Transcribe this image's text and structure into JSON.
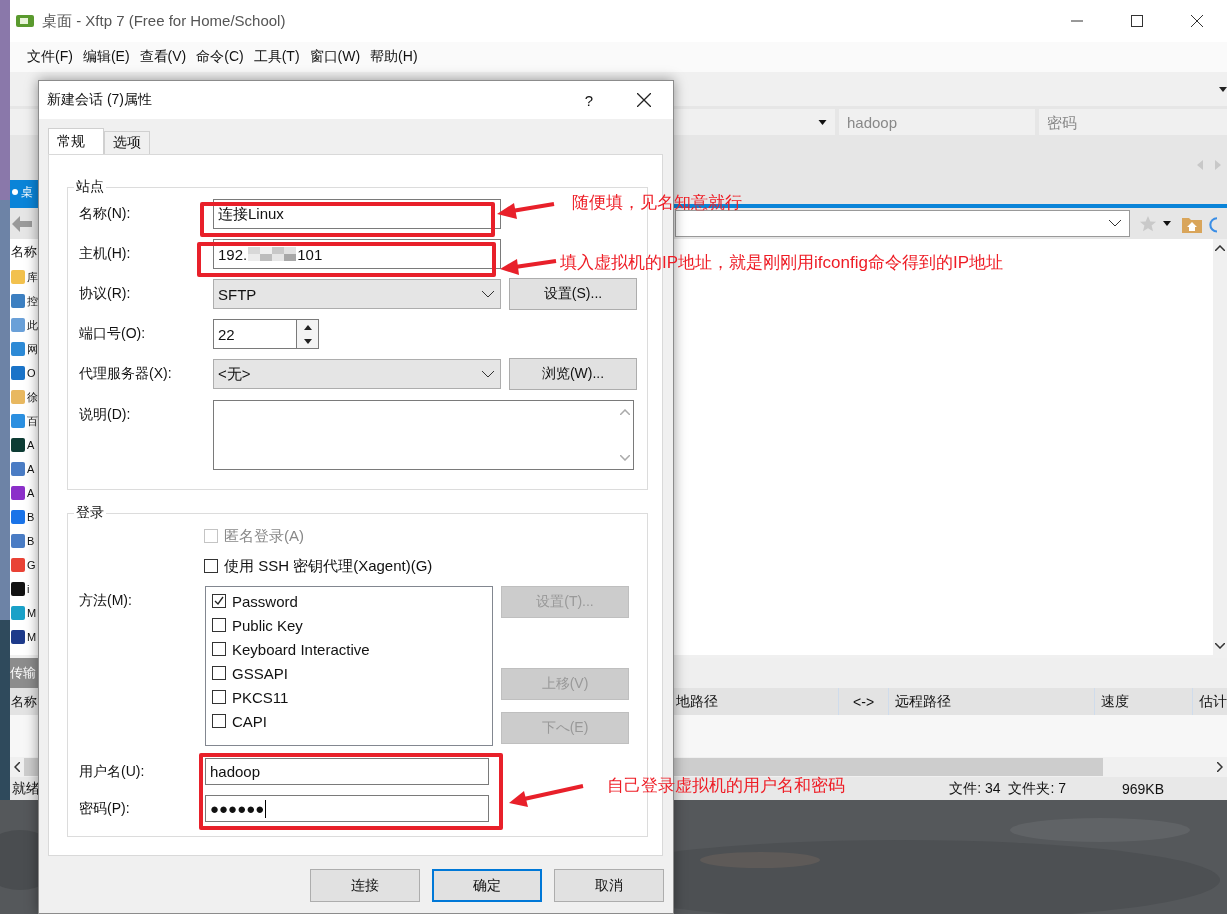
{
  "app_window": {
    "title": "桌面 - Xftp 7 (Free for Home/School)",
    "menu": [
      "文件(F)",
      "编辑(E)",
      "查看(V)",
      "命令(C)",
      "工具(T)",
      "窗口(W)",
      "帮助(H)"
    ],
    "session_bar": {
      "username": "hadoop",
      "password_placeholder": "密码"
    },
    "local_tab": {
      "label": "桌"
    },
    "file_list": {
      "column": "名称",
      "items": [
        {
          "label": "库",
          "color": "#f2c14e"
        },
        {
          "label": "控",
          "color": "#3c7fc1"
        },
        {
          "label": "此",
          "color": "#6aa0d8"
        },
        {
          "label": "网",
          "color": "#2d8ad6"
        },
        {
          "label": "O",
          "color": "#1a73c8"
        },
        {
          "label": "徐",
          "color": "#e8b860"
        },
        {
          "label": "百",
          "color": "#2b8fe0"
        },
        {
          "label": "A",
          "color": "#0d3c34"
        },
        {
          "label": "A",
          "color": "#4a7cc4"
        },
        {
          "label": "A",
          "color": "#8b2fc9"
        },
        {
          "label": "B",
          "color": "#1a73e8"
        },
        {
          "label": "B",
          "color": "#4a7cc4"
        },
        {
          "label": "G",
          "color": "#e94235"
        },
        {
          "label": "i",
          "color": "#111111"
        },
        {
          "label": "M",
          "color": "#1aa1c8"
        },
        {
          "label": "M",
          "color": "#1d3a8a"
        }
      ]
    },
    "transfer_pane": {
      "title": "传输",
      "columns": [
        "名称",
        "地路径",
        "<->",
        "远程路径",
        "速度",
        "估计"
      ]
    },
    "status_bar": {
      "state": "就绪",
      "counts": "文件: 34  文件夹: 7",
      "size": "969KB"
    }
  },
  "dialog": {
    "title": "新建会话 (7)属性",
    "help": "?",
    "tabs": [
      {
        "label": "常规",
        "selected": true
      },
      {
        "label": "选项",
        "selected": false
      }
    ],
    "site": {
      "legend": "站点",
      "name": {
        "label": "名称(N):",
        "value": "连接Linux"
      },
      "host": {
        "label": "主机(H):",
        "value_start": "192.",
        "value_end": "101"
      },
      "protocol": {
        "label": "协议(R):",
        "value": "SFTP",
        "button": "设置(S)..."
      },
      "port": {
        "label": "端口号(O):",
        "value": "22"
      },
      "proxy": {
        "label": "代理服务器(X):",
        "value": "<无>",
        "button": "浏览(W)..."
      },
      "description": {
        "label": "说明(D):"
      }
    },
    "login": {
      "legend": "登录",
      "anonymous": {
        "label": "匿名登录(A)",
        "checked": false,
        "disabled": true
      },
      "agent": {
        "label": "使用 SSH 密钥代理(Xagent)(G)",
        "checked": false,
        "disabled": false
      },
      "method": {
        "label": "方法(M):",
        "options": [
          {
            "label": "Password",
            "checked": true
          },
          {
            "label": "Public Key",
            "checked": false
          },
          {
            "label": "Keyboard Interactive",
            "checked": false
          },
          {
            "label": "GSSAPI",
            "checked": false
          },
          {
            "label": "PKCS11",
            "checked": false
          },
          {
            "label": "CAPI",
            "checked": false
          }
        ],
        "settings_button": {
          "label": "设置(T)...",
          "disabled": true
        },
        "up_button": {
          "label": "上移(V)",
          "disabled": true
        },
        "down_button": {
          "label": "下へ(E)",
          "disabled": true
        }
      },
      "username": {
        "label": "用户名(U):",
        "value": "hadoop"
      },
      "password": {
        "label": "密码(P):",
        "value": "●●●●●●"
      }
    },
    "buttons": [
      {
        "label": "连接",
        "default": false
      },
      {
        "label": "确定",
        "default": true
      },
      {
        "label": "取消",
        "default": false
      }
    ]
  },
  "annotations": [
    "随便填，见名知意就行",
    "填入虚拟机的IP地址，就是刚刚用ifconfig命令得到的IP地址",
    "自己登录虚拟机的用户名和密码"
  ]
}
